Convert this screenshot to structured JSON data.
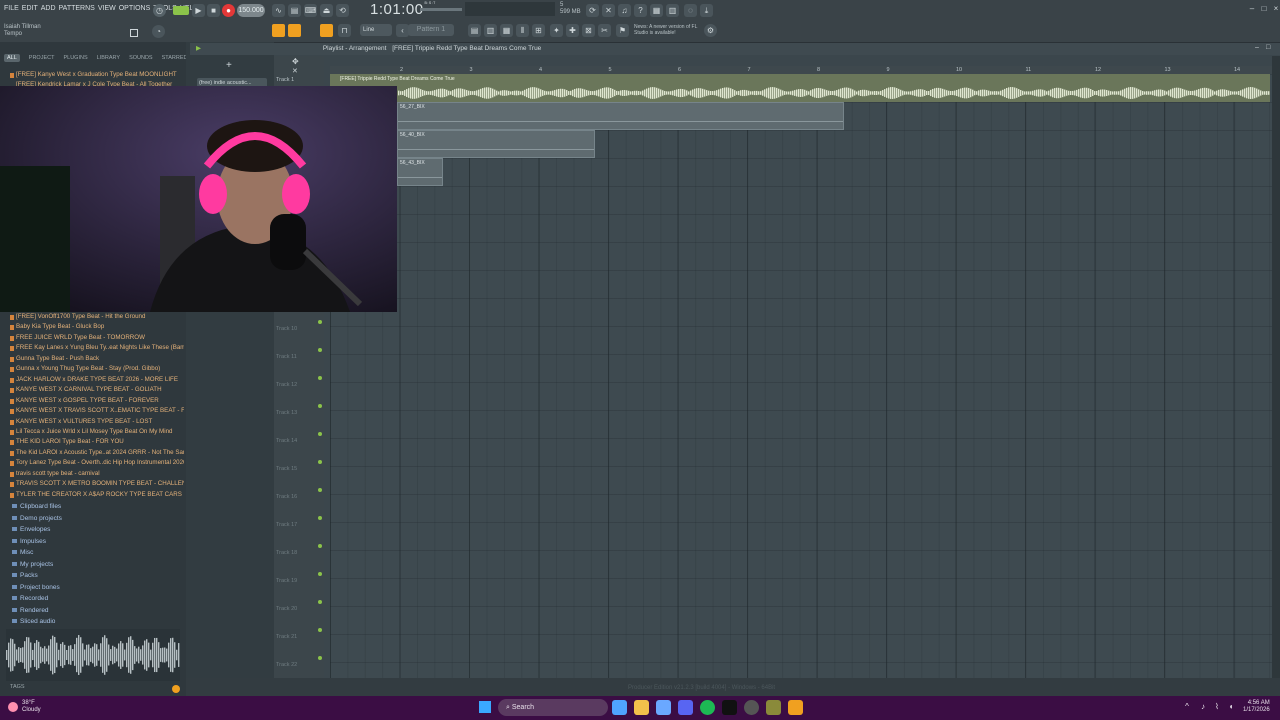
{
  "menu": [
    "FILE",
    "EDIT",
    "ADD",
    "PATTERNS",
    "VIEW",
    "OPTIONS",
    "TOOLS",
    "HELP"
  ],
  "transport": {
    "tempo": "150.000",
    "time": "1:01:00",
    "time_suffix": "B:S:T",
    "memory": "599 MB",
    "cpu_line": "5",
    "hint_user": "Isaiah Tillman",
    "hint_label": "Tempo"
  },
  "toolbar": {
    "snap_label": "Line",
    "pattern_label": "Pattern 1",
    "news_text": "News: A newer version of FL Studio is available!"
  },
  "browser": {
    "tabs": [
      "ALL",
      "PROJECT",
      "PLUGINS",
      "LIBRARY",
      "SOUNDS",
      "STARRED"
    ],
    "top_files": [
      "[FREE] Kanye West x Graduation Type Beat MOONLIGHT",
      "[FREE] Kendrick Lamar x J Cole Type Beat - All Together"
    ],
    "files": [
      "[FREE] VonOff1700 Type Beat - Hit the Ground",
      "Baby Kia Type Beat - Gluck Bop",
      "FREE JUICE WRLD Type Beat - TOMORROW",
      "FREE Kay Lanes x Yung Bleu Ty..eat Nights Like These (Bamegk)",
      "Gunna Type Beat - Push Back",
      "Gunna x Young Thug Type Beat - Stay (Prod. Gibbo)",
      "JACK HARLOW x DRAKE TYPE BEAT 2026 - MORE LIFE",
      "KANYE WEST X CARNIVAL TYPE BEAT - GOLIATH",
      "KANYE WEST x GOSPEL TYPE BEAT - FOREVER",
      "KANYE WEST X TRAVIS SCOTT X..EMATIC TYPE BEAT - FORSAKEN",
      "KANYE WEST x VULTURES TYPE BEAT - LOST",
      "Lil Tecca x Juice Wrld x Lil Mosey Type Beat On My Mind",
      "THE KID LAROI Type Beat - FOR YOU",
      "The Kid LAROI x Acoustic Type..at 2024 GRRR - Not The Same",
      "Tory Lanez Type Beat - Overth..dic Hip Hop Instrumental 2026",
      "travis scott type beat - carnival",
      "TRAVIS SCOTT X METRO BOOMIN TYPE BEAT - CHALLENGE",
      "TYLER THE CREATOR X A$AP ROCKY TYPE BEAT CARS"
    ],
    "folders": [
      "Clipboard files",
      "Demo projects",
      "Envelopes",
      "Impulses",
      "Misc",
      "My projects",
      "Packs",
      "Project bones",
      "Recorded",
      "Rendered",
      "Sliced audio"
    ],
    "tags_label": "TAGS"
  },
  "playlist": {
    "title": "Playlist - Arrangement",
    "project_name": "[FREE] Trippie Redd Type Beat Dreams Come True",
    "pattern_selector": "(free) indie acoustic...",
    "master_clip": "[FREE] Trippie Redd Type Beat Dreams Come True",
    "clips": [
      "56_27_BIX",
      "56_40_BIX",
      "56_43_BIX"
    ],
    "ruler": [
      "2",
      "3",
      "4",
      "5",
      "6",
      "7",
      "8",
      "9",
      "10",
      "11",
      "12",
      "13",
      "14"
    ],
    "track1": "Track 1",
    "tracks": [
      "Track 10",
      "Track 11",
      "Track 12",
      "Track 13",
      "Track 14",
      "Track 15",
      "Track 16",
      "Track 17",
      "Track 18",
      "Track 19",
      "Track 20",
      "Track 21",
      "Track 22"
    ]
  },
  "status_line": "Producer Edition v21.2.3 [build 4004] - Windows - 64Bit",
  "taskbar": {
    "weather_temp": "38°F",
    "weather_desc": "Cloudy",
    "search_label": "Search",
    "time": "4:56 AM",
    "date": "1/17/2026"
  },
  "colors": {
    "accent": "#f0a020",
    "record": "#e33838",
    "taskbar": "#3b0d44",
    "clip": "#5f6b70",
    "file_text": "#e5b27a",
    "folder_text": "#a9c3e6"
  }
}
